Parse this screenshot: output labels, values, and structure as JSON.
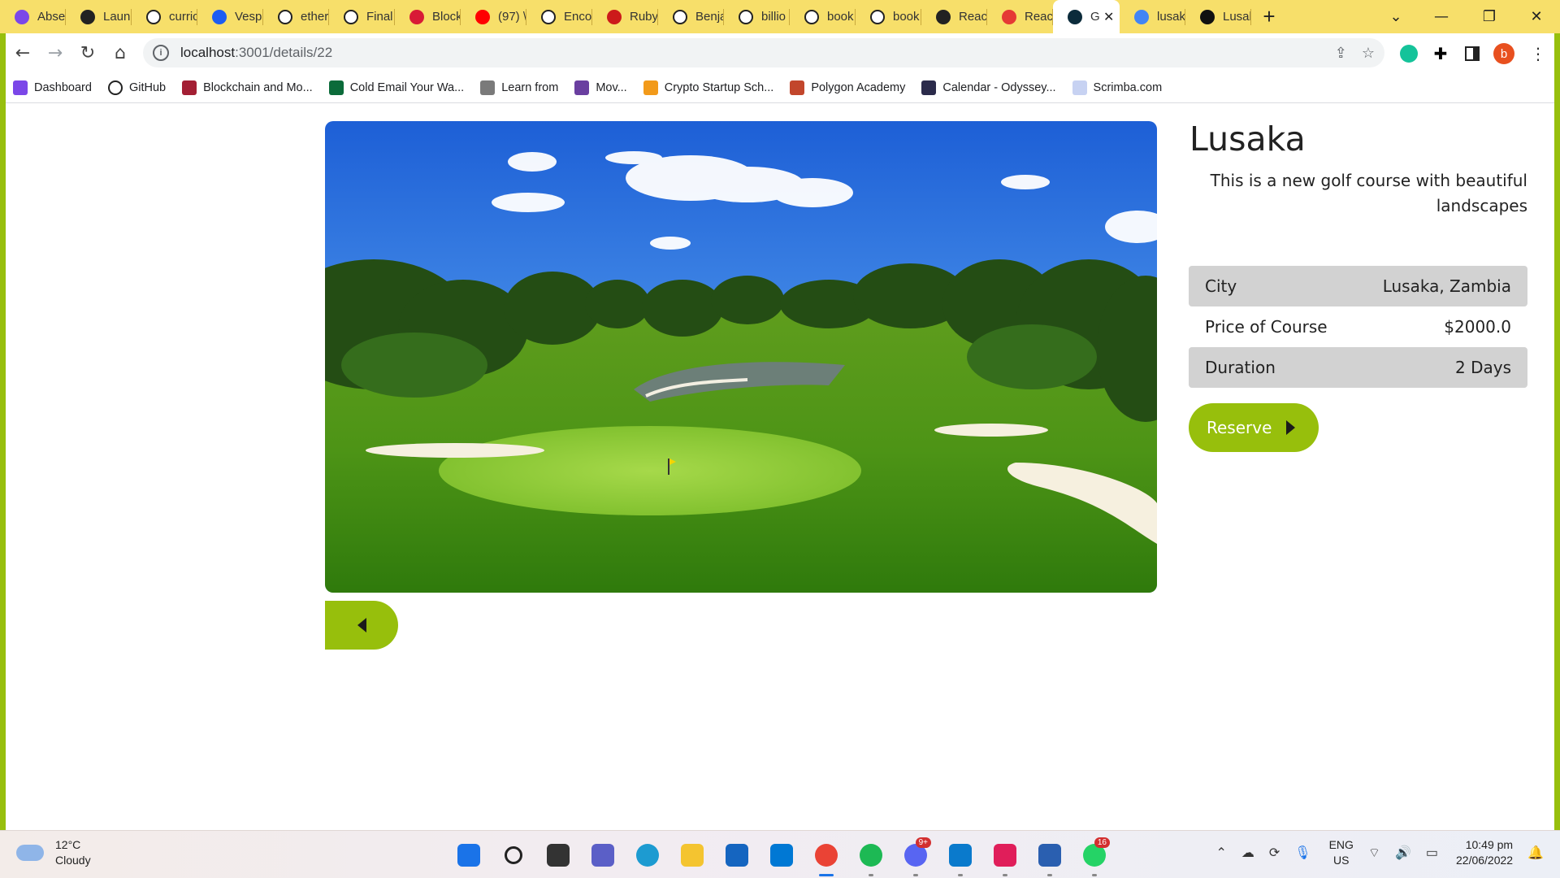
{
  "browser": {
    "tabs": [
      {
        "title": "Abse",
        "icon": "purple-logo-icon",
        "color": "#7b47e8"
      },
      {
        "title": "Laun",
        "icon": "globe-icon",
        "color": "#222222"
      },
      {
        "title": "curric",
        "icon": "github-icon",
        "color": "#ffffff"
      },
      {
        "title": "Vesp",
        "icon": "behance-icon",
        "color": "#1c5df2"
      },
      {
        "title": "ether",
        "icon": "github-icon",
        "color": "#ffffff"
      },
      {
        "title": "Final",
        "icon": "github-icon",
        "color": "#ffffff"
      },
      {
        "title": "Block",
        "icon": "angular-icon",
        "color": "#d81b36"
      },
      {
        "title": "(97) \\",
        "icon": "youtube-icon",
        "color": "#ff0000"
      },
      {
        "title": "Enco",
        "icon": "github-icon",
        "color": "#ffffff"
      },
      {
        "title": "Ruby",
        "icon": "ruby-icon",
        "color": "#cc1a1a"
      },
      {
        "title": "Benja",
        "icon": "github-icon",
        "color": "#ffffff"
      },
      {
        "title": "billio",
        "icon": "github-icon",
        "color": "#ffffff"
      },
      {
        "title": "book",
        "icon": "github-icon",
        "color": "#ffffff"
      },
      {
        "title": "book",
        "icon": "github-icon",
        "color": "#ffffff"
      },
      {
        "title": "Reac",
        "icon": "globe-icon",
        "color": "#222222"
      },
      {
        "title": "Reac",
        "icon": "vercel-icon",
        "color": "#e53935"
      }
    ],
    "active_tab": {
      "title": "G",
      "icon": "react-icon"
    },
    "tabs_after": [
      {
        "title": "lusak",
        "icon": "google-icon",
        "color": "#4285f4"
      },
      {
        "title": "Lusal",
        "icon": "app-icon",
        "color": "#111111"
      }
    ],
    "new_tab": "+",
    "url_host": "localhost",
    "url_path": ":3001/details/22",
    "bookmarks": [
      {
        "label": "Dashboard",
        "icon": "purple-logo-icon",
        "color": "#7b47e8"
      },
      {
        "label": "GitHub",
        "icon": "github-icon",
        "color": "#ffffff"
      },
      {
        "label": "Blockchain and Mo...",
        "icon": "mit-icon",
        "color": "#a31f34"
      },
      {
        "label": "Cold Email Your Wa...",
        "icon": "ck-icon",
        "color": "#0b6b3a"
      },
      {
        "label": "Learn from",
        "icon": "tools-icon",
        "color": "#7a7a7a"
      },
      {
        "label": "Mov...",
        "icon": "film-icon",
        "color": "#6a3fa0"
      },
      {
        "label": "Crypto Startup Sch...",
        "icon": "a16z-icon",
        "color": "#f29a1a"
      },
      {
        "label": "Polygon Academy",
        "icon": "house-icon",
        "color": "#c2462c"
      },
      {
        "label": "Calendar - Odyssey...",
        "icon": "calendar-icon",
        "color": "#2b2b4b"
      },
      {
        "label": "Scrimba.com",
        "icon": "scrimba-icon",
        "color": "#c7d2f2"
      }
    ],
    "profile_letter": "b"
  },
  "page": {
    "title": "Lusaka",
    "description": "This is a new golf course with beautiful landscapes",
    "details": [
      {
        "label": "City",
        "value": "Lusaka, Zambia"
      },
      {
        "label": "Price of Course",
        "value": "$2000.0"
      },
      {
        "label": "Duration",
        "value": "2 Days"
      }
    ],
    "reserve_label": "Reserve",
    "accent": "#97bf0c",
    "hero_image": "golf-course-landscape"
  },
  "taskbar": {
    "weather_temp": "12°C",
    "weather_desc": "Cloudy",
    "apps": [
      {
        "name": "windows-start-icon",
        "color": "#1a73e8"
      },
      {
        "name": "search-icon",
        "color": "#222222"
      },
      {
        "name": "task-view-icon",
        "color": "#333333"
      },
      {
        "name": "teams-chat-icon",
        "color": "#5b5fc7"
      },
      {
        "name": "edge-icon",
        "color": "#1d9bd1"
      },
      {
        "name": "file-explorer-icon",
        "color": "#f4c430"
      },
      {
        "name": "mail-icon",
        "color": "#1565c0"
      },
      {
        "name": "app-store-icon",
        "color": "#0078d4"
      },
      {
        "name": "chrome-icon",
        "color": "#ea4335"
      },
      {
        "name": "spotify-icon",
        "color": "#1db954"
      },
      {
        "name": "discord-icon",
        "color": "#5865f2",
        "badge": "9+"
      },
      {
        "name": "vscode-icon",
        "color": "#0a7acc"
      },
      {
        "name": "slack-icon",
        "color": "#e01e5a"
      },
      {
        "name": "powershell-icon",
        "color": "#2a5fb0"
      },
      {
        "name": "whatsapp-icon",
        "color": "#25d366",
        "badge": "16"
      }
    ],
    "lang": "ENG",
    "region": "US",
    "time": "10:49 pm",
    "date": "22/06/2022"
  }
}
